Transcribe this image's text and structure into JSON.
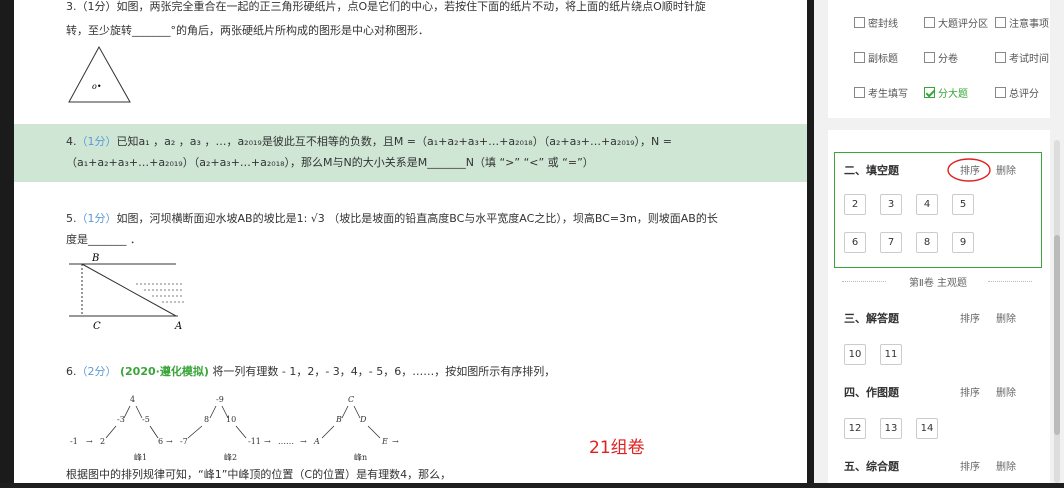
{
  "q3": {
    "line1": "3.（1分）如图，两张完全重合在一起的正三角形硬纸片，点O是它们的中心，若按住下面的纸片不动，将上面的纸片绕点O顺时针旋",
    "line2": "转，至少旋转_______°的角后，两张硬纸片所构成的图形是中心对称图形．",
    "figure_label": "o•"
  },
  "q4": {
    "number": "4.",
    "score": "（1分）",
    "line1": "已知a₁ ，a₂ ，a₃ ，…，a₂₀₁₉是彼此互不相等的负数，且M =（a₁+a₂+a₃+…+a₂₀₁₈）（a₂+a₃+…+a₂₀₁₉），N =",
    "line2": "（a₁+a₂+a₃+…+a₂₀₁₉）（a₂+a₃+…+a₂₀₁₈），那么M与N的大小关系是M_______N（填 “>”  “<” 或 “=”）"
  },
  "q5": {
    "number": "5.",
    "score": "（1分）",
    "line1": "如图，河坝横断面迎水坡AB的坡比是1: √3 （坡比是坡面的铅直高度BC与水平宽度AC之比），坝高BC=3m，则坡面AB的长",
    "line2": "度是_______ ．",
    "label_b": "B",
    "label_c": "C",
    "label_a": "A"
  },
  "q6": {
    "number": "6.",
    "score": "（2分）",
    "source": "(2020·遵化模拟)",
    "line1": "将一列有理数 - 1，2，- 3，4，- 5，6，……，按如图所示有序排列，",
    "line_bottom": "根据图中的排列规律可知，“峰1”中峰顶的位置（C的位置）是有理数4，那么，",
    "peak1": "峰1",
    "peak2": "峰2",
    "peakn": "峰n"
  },
  "stamp": "21组卷",
  "options": {
    "seal_line": "密封线",
    "big_score_area": "大题评分区",
    "notes": "注意事项",
    "subtitle": "副标题",
    "split_volume": "分卷",
    "exam_time": "考试时间",
    "candidate_fill": "考生填写",
    "big_score": "分大题",
    "total_score": "总评分"
  },
  "sections": {
    "fill": {
      "title": "二、填空题",
      "sort": "排序",
      "delete": "删除",
      "buttons": [
        "2",
        "3",
        "4",
        "5",
        "6",
        "7",
        "8",
        "9"
      ]
    },
    "volume2": "第Ⅱ卷 主观题",
    "answer": {
      "title": "三、解答题",
      "sort": "排序",
      "delete": "删除",
      "buttons": [
        "10",
        "11"
      ]
    },
    "drawing": {
      "title": "四、作图题",
      "sort": "排序",
      "delete": "删除",
      "buttons": [
        "12",
        "13",
        "14"
      ]
    },
    "comprehensive": {
      "title": "五、综合题",
      "sort": "排序",
      "delete": "删除"
    }
  },
  "colors": {
    "highlight": "#cfe6d5",
    "accent_green": "#3aa53a",
    "annotation_red": "#e02020",
    "score_blue": "#5b9bd5"
  }
}
